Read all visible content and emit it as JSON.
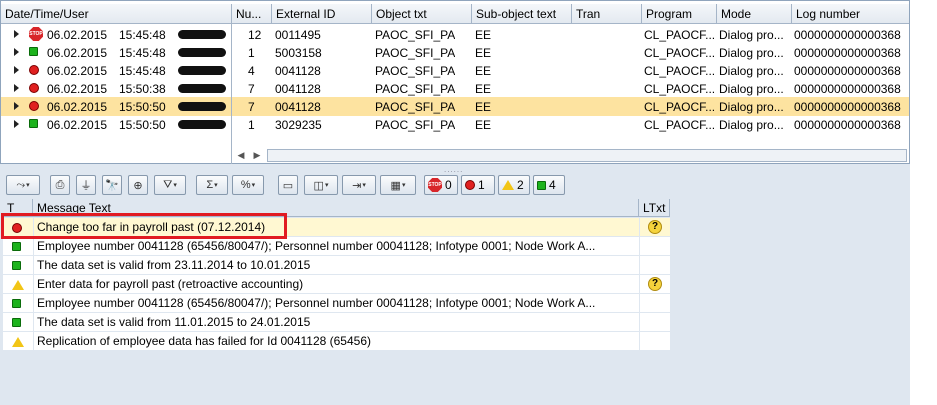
{
  "log_table": {
    "columns": [
      "Date/Time/User",
      "Nu...",
      "External ID",
      "Object txt",
      "Sub-object text",
      "Tran",
      "Program",
      "Mode",
      "Log number"
    ],
    "rows": [
      {
        "icon": "stop",
        "date": "06.02.2015",
        "time": "15:45:48",
        "num": "12",
        "ext_id": "0011495",
        "obj": "PAOC_SFI_PA",
        "sub": "EE",
        "tran": "",
        "prog": "CL_PAOCF...",
        "mode": "Dialog pro...",
        "log": "0000000000000368"
      },
      {
        "icon": "green",
        "date": "06.02.2015",
        "time": "15:45:48",
        "num": "1",
        "ext_id": "5003158",
        "obj": "PAOC_SFI_PA",
        "sub": "EE",
        "tran": "",
        "prog": "CL_PAOCF...",
        "mode": "Dialog pro...",
        "log": "0000000000000368"
      },
      {
        "icon": "red",
        "date": "06.02.2015",
        "time": "15:45:48",
        "num": "4",
        "ext_id": "0041128",
        "obj": "PAOC_SFI_PA",
        "sub": "EE",
        "tran": "",
        "prog": "CL_PAOCF...",
        "mode": "Dialog pro...",
        "log": "0000000000000368"
      },
      {
        "icon": "red",
        "date": "06.02.2015",
        "time": "15:50:38",
        "num": "7",
        "ext_id": "0041128",
        "obj": "PAOC_SFI_PA",
        "sub": "EE",
        "tran": "",
        "prog": "CL_PAOCF...",
        "mode": "Dialog pro...",
        "log": "0000000000000368"
      },
      {
        "icon": "red",
        "date": "06.02.2015",
        "time": "15:50:50",
        "num": "7",
        "ext_id": "0041128",
        "obj": "PAOC_SFI_PA",
        "sub": "EE",
        "tran": "",
        "prog": "CL_PAOCF...",
        "mode": "Dialog pro...",
        "log": "0000000000000368",
        "selected": true
      },
      {
        "icon": "green",
        "date": "06.02.2015",
        "time": "15:50:50",
        "num": "1",
        "ext_id": "3029235",
        "obj": "PAOC_SFI_PA",
        "sub": "EE",
        "tran": "",
        "prog": "CL_PAOCF...",
        "mode": "Dialog pro...",
        "log": "0000000000000368"
      }
    ]
  },
  "toolbar": {
    "stop_count": "0",
    "error_count": "1",
    "warning_count": "2",
    "info_count": "4"
  },
  "messages": {
    "columns": [
      "T",
      "Message Text",
      "LTxt"
    ],
    "rows": [
      {
        "type": "red",
        "text": "Change too far in payroll past (07.12.2014)",
        "ltxt": true,
        "selected": true
      },
      {
        "type": "green",
        "text": "Employee number 0041128 (65456/80047/); Personnel number 00041128; Infotype 0001; Node Work A...",
        "ltxt": false
      },
      {
        "type": "green",
        "text": "The data set is valid from 23.11.2014 to 10.01.2015",
        "ltxt": false
      },
      {
        "type": "yellow",
        "text": "Enter data for payroll past (retroactive accounting)",
        "ltxt": true
      },
      {
        "type": "green",
        "text": "Employee number 0041128 (65456/80047/); Personnel number 00041128; Infotype 0001; Node Work A...",
        "ltxt": false
      },
      {
        "type": "green",
        "text": "The data set is valid from 11.01.2015 to 24.01.2015",
        "ltxt": false
      },
      {
        "type": "yellow",
        "text": "Replication of employee data has failed for Id 0041128 (65456)",
        "ltxt": false
      }
    ]
  },
  "colors": {
    "selection": "#fde3a0",
    "highlight_box": "#e11b22",
    "error": "#e02020",
    "success": "#1db31d",
    "warning": "#f2c516"
  }
}
